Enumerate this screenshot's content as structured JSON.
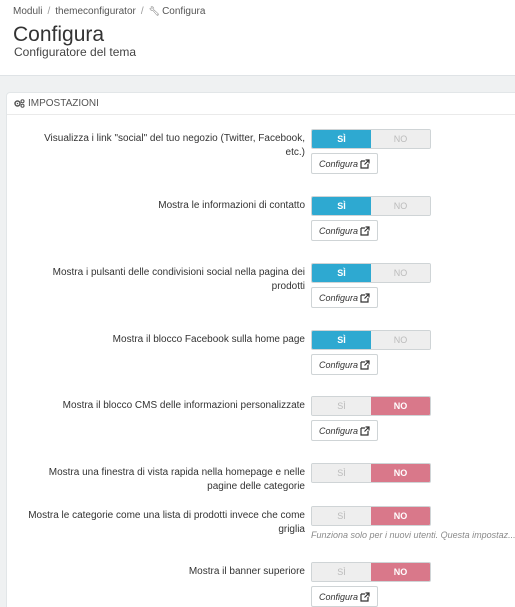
{
  "breadcrumb": {
    "root": "Moduli",
    "module": "themeconfigurator",
    "current": "Configura",
    "separator": "/"
  },
  "page": {
    "title": "Configura",
    "subtitle": "Configuratore del tema"
  },
  "panel": {
    "heading": "IMPOSTAZIONI"
  },
  "switch_labels": {
    "yes": "SÌ",
    "no": "NO"
  },
  "configure_label": "Configura",
  "settings": [
    {
      "label": "Visualizza i link \"social\" del tuo negozio (Twitter, Facebook, etc.)",
      "value": true
    },
    {
      "label": "Mostra le informazioni di contatto",
      "value": true
    },
    {
      "label": "Mostra i pulsanti delle condivisioni social nella pagina dei prodotti",
      "value": true
    },
    {
      "label": "Mostra il blocco Facebook sulla home page",
      "value": true
    },
    {
      "label": "Mostra il blocco CMS delle informazioni personalizzate",
      "value": false
    },
    {
      "label": "Mostra una finestra di vista rapida nella homepage e nelle pagine delle categorie",
      "value": false
    },
    {
      "label": "Mostra le categorie come una lista di prodotti invece che come griglia",
      "value": false,
      "hint": "Funziona solo per i nuovi utenti. Questa impostaz..."
    },
    {
      "label": "Mostra il banner superiore",
      "value": false
    }
  ],
  "colors": {
    "yes_active": "#2ea9d1",
    "no_active": "#d9788a",
    "background": "#eff1f2"
  },
  "icons": {
    "breadcrumb_current": "wrench-icon",
    "panel_heading": "cogs-icon",
    "configure_button": "external-link-icon"
  }
}
